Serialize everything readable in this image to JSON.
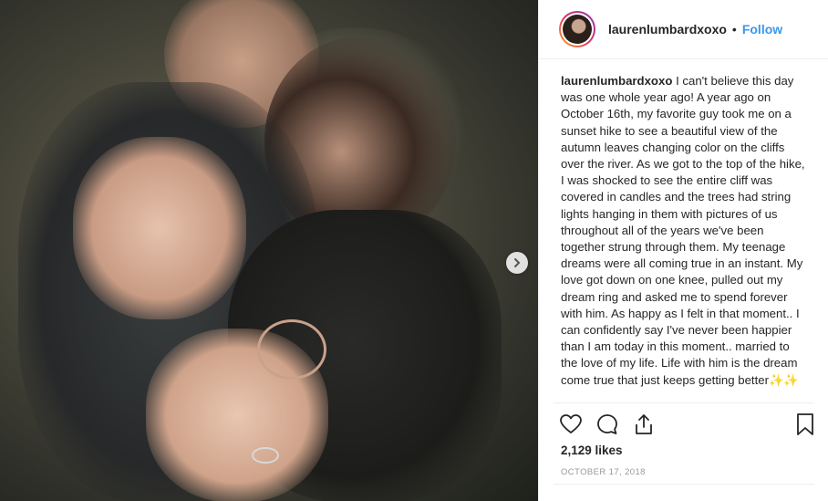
{
  "post": {
    "username": "laurenlumbardxoxo",
    "separator": "•",
    "follow_label": "Follow",
    "caption": "I can't believe this day was one whole year ago! A year ago on October 16th, my favorite guy took me on a sunset hike to see a beautiful view of the autumn leaves changing color on the cliffs over the river. As we got to the top of the hike, I was shocked to see the entire cliff was covered in candles and the trees had string lights hanging in them with pictures of us throughout all of the years we've been together strung through them. My teenage dreams were all coming true in an instant. My love got down on one knee, pulled out my dream ring and asked me to spend forever with him. As happy as I felt in that moment.. I can confidently say I've never been happier than I am today in this moment.. married to the love of my life. Life with him is the dream come true that just keeps getting better✨✨",
    "likes": "2,129 likes",
    "date": "OCTOBER 17, 2018"
  },
  "icons": {
    "like": "heart-icon",
    "comment": "comment-icon",
    "share": "share-icon",
    "save": "bookmark-icon",
    "next": "chevron-right-icon"
  },
  "colors": {
    "follow": "#3897f0",
    "text": "#262626",
    "muted": "#999999",
    "border": "#efefef"
  }
}
